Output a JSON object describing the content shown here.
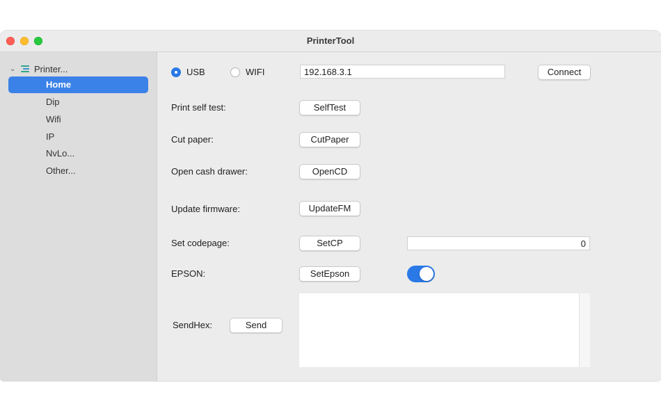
{
  "window": {
    "title": "PrinterTool"
  },
  "sidebar": {
    "root_label": "Printer...",
    "items": [
      {
        "label": "Home",
        "selected": true
      },
      {
        "label": "Dip"
      },
      {
        "label": "Wifi"
      },
      {
        "label": "IP"
      },
      {
        "label": "NvLo..."
      },
      {
        "label": "Other..."
      }
    ]
  },
  "connection": {
    "usb_label": "USB",
    "usb_selected": true,
    "wifi_label": "WIFI",
    "ip_value": "192.168.3.1",
    "connect_label": "Connect"
  },
  "actions": {
    "self_test_label": "Print self test:",
    "self_test_button": "SelfTest",
    "cut_paper_label": "Cut paper:",
    "cut_paper_button": "CutPaper",
    "cash_drawer_label": "Open cash drawer:",
    "cash_drawer_button": "OpenCD",
    "firmware_label": "Update firmware:",
    "firmware_button": "UpdateFM",
    "codepage_label": "Set codepage:",
    "codepage_button": "SetCP",
    "codepage_value": "0",
    "epson_label": "EPSON:",
    "epson_button": "SetEpson",
    "epson_enabled": true,
    "sendhex_label": "SendHex:",
    "send_button": "Send",
    "hex_value": ""
  },
  "colors": {
    "accent": "#2a79e6",
    "selection": "#3b82e8"
  }
}
